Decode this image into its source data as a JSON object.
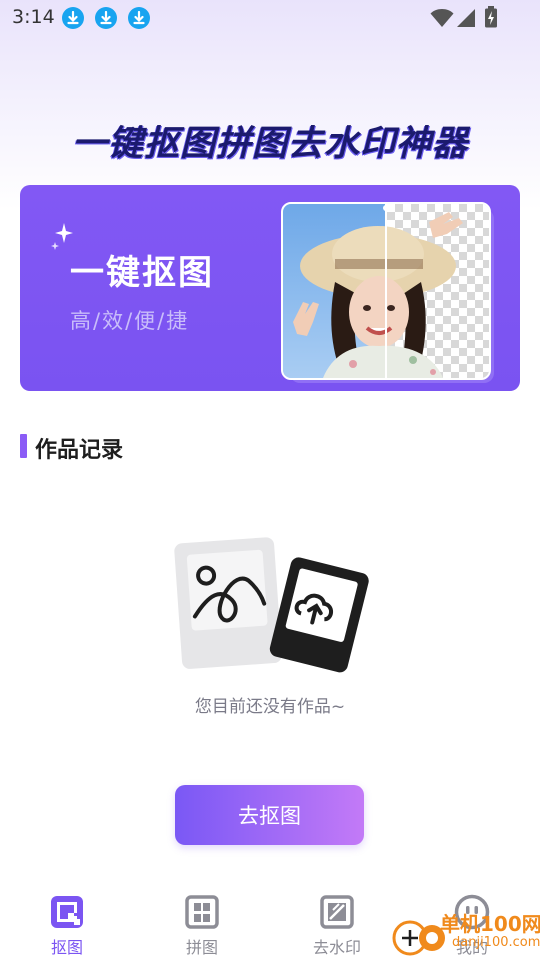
{
  "status_bar": {
    "time": "3:14"
  },
  "headline": "一键抠图拼图去水印神器",
  "banner": {
    "title": "一键抠图",
    "subtitle": "高/效/便/捷"
  },
  "section": {
    "title": "作品记录"
  },
  "empty_state": {
    "message": "您目前还没有作品~"
  },
  "cta": {
    "label": "去抠图"
  },
  "tabs": [
    {
      "label": "抠图",
      "icon": "cutout-icon",
      "active": true
    },
    {
      "label": "拼图",
      "icon": "collage-icon",
      "active": false
    },
    {
      "label": "去水印",
      "icon": "watermark-remove-icon",
      "active": false
    },
    {
      "label": "我的",
      "icon": "profile-face-icon",
      "active": false
    }
  ],
  "watermark": {
    "line1": "单机100网",
    "line2": "danji100.com"
  },
  "colors": {
    "accent": "#7b55f2",
    "headline": "#1b1a6e",
    "tab_active": "#7b55f2",
    "tab_inactive": "#8d8d96",
    "download_badge": "#18a4f0"
  }
}
